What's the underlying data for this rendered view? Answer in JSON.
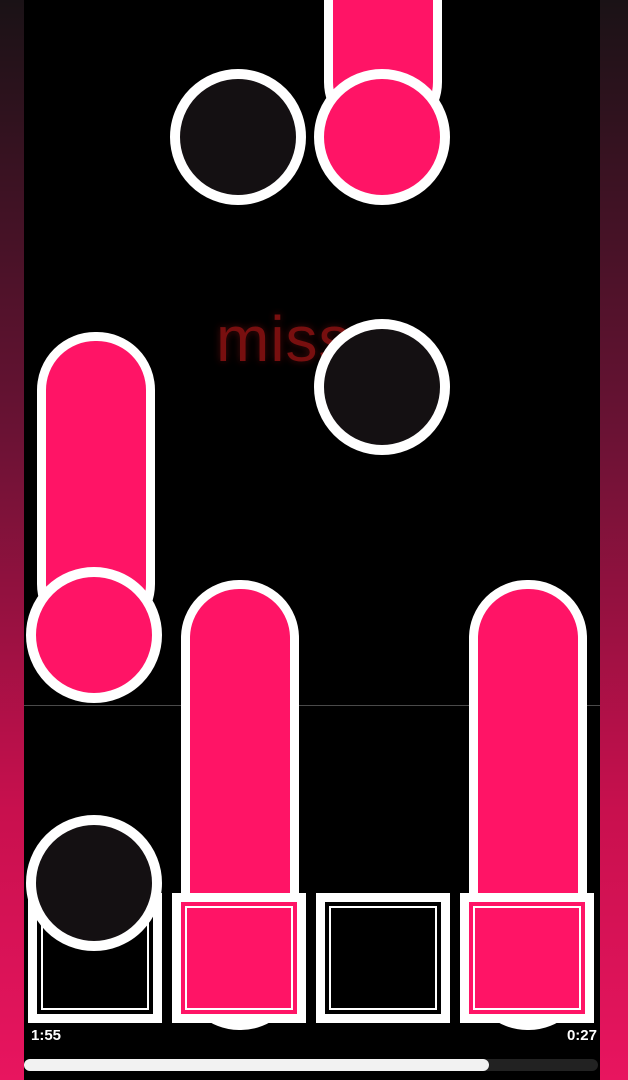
{
  "hud": {
    "judgement": "miss...",
    "time_elapsed": "1:55",
    "time_remaining": "0:27"
  },
  "progress": {
    "fraction": 0.81
  },
  "colors": {
    "note_pink": "#ff1466",
    "note_dark": "#141012",
    "outline": "#ffffff",
    "judgement_red": "#c81a1a"
  },
  "lanes": [
    {
      "lane": 1,
      "pressed": false
    },
    {
      "lane": 2,
      "pressed": true
    },
    {
      "lane": 3,
      "pressed": false
    },
    {
      "lane": 4,
      "pressed": true
    }
  ]
}
